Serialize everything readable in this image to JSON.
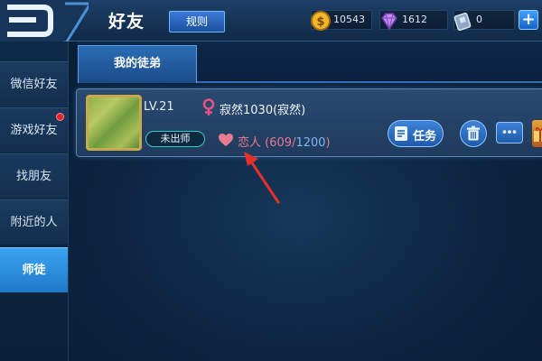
{
  "header": {
    "title": "好友",
    "rules_label": "规则",
    "back_icon": "back-arrow-icon",
    "resources": {
      "gold": {
        "value": "10543",
        "icon": "gold-coin-icon"
      },
      "gems": {
        "value": "1612",
        "icon": "diamond-icon"
      },
      "tickets": {
        "value": "0",
        "icon": "ticket-icon"
      }
    },
    "add_label": "+"
  },
  "sidebar": {
    "items": [
      {
        "label": "微信好友",
        "active": false,
        "badge": false
      },
      {
        "label": "游戏好友",
        "active": false,
        "badge": true
      },
      {
        "label": "找朋友",
        "active": false,
        "badge": false
      },
      {
        "label": "附近的人",
        "active": false,
        "badge": false
      },
      {
        "label": "师徒",
        "active": true,
        "badge": false
      }
    ]
  },
  "subtab": {
    "label": "我的徒弟"
  },
  "apprentice": {
    "level": "LV.21",
    "gender_icon": "female-icon",
    "name": "寂然1030(寂然)",
    "status": "未出师",
    "relation": {
      "label": "恋人",
      "current": "609",
      "max": "1200"
    },
    "task_label": "任务"
  },
  "colors": {
    "accent_blue": "#1f79c9",
    "relation_pink": "#e97a8f",
    "annotation_red": "#e8302a"
  }
}
